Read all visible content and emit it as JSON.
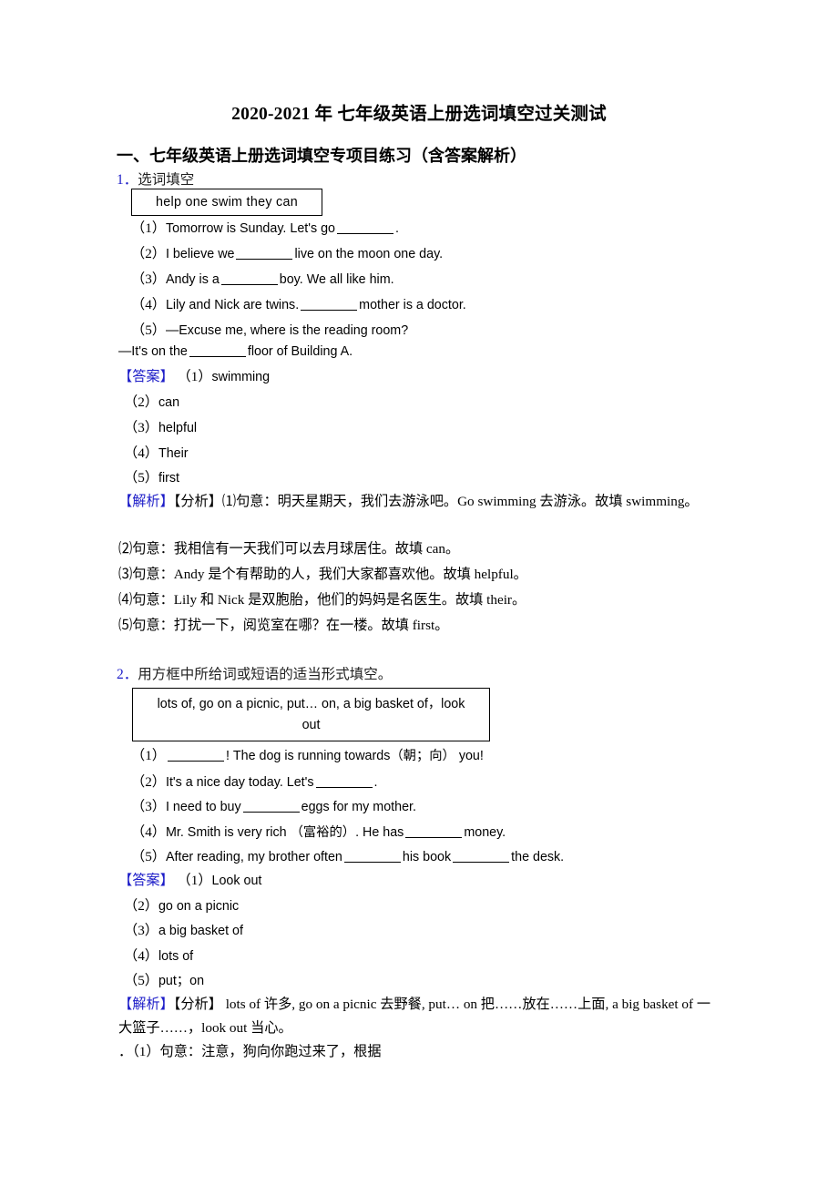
{
  "document": {
    "title": "2020-2021 年  七年级英语上册选词填空过关测试",
    "section_heading": "一、七年级英语上册选词填空专项目练习（含答案解析）",
    "accent_color": "#1d1dc8",
    "text_color": "#000000",
    "background": "#ffffff"
  },
  "exercises": [
    {
      "number": "1．",
      "prompt": "选词填空",
      "wordbank": "help    one    swim    they    can",
      "questions": [
        {
          "label": "（1）",
          "before": "Tomorrow is Sunday. Let's go",
          "after": "."
        },
        {
          "label": "（2）",
          "before": "I believe we",
          "after": "live on the moon one day."
        },
        {
          "label": "（3）",
          "before": "Andy is a",
          "after": "boy. We all like him."
        },
        {
          "label": "（4）",
          "before": "Lily and Nick are twins.",
          "after": "mother is a doctor."
        },
        {
          "label": "（5）",
          "before": "—Excuse me, where is the reading room?",
          "after": ""
        }
      ],
      "continuation": {
        "before": "—It's on the",
        "after": "floor of Building A."
      },
      "answer_label": "【答案】",
      "answers": [
        {
          "label": "（1）",
          "value": "swimming"
        },
        {
          "label": "（2）",
          "value": "can"
        },
        {
          "label": "（3）",
          "value": "helpful"
        },
        {
          "label": "（4）",
          "value": "Their"
        },
        {
          "label": "（5）",
          "value": "first"
        }
      ],
      "analysis_label": "【解析】",
      "analysis_sub_label": "【分析】",
      "analysis_first": "⑴句意：明天星期天，我们去游泳吧。Go swimming 去游泳。故填 swimming。",
      "analysis_items": [
        "⑵句意：我相信有一天我们可以去月球居住。故填 can。",
        "⑶句意：Andy 是个有帮助的人，我们大家都喜欢他。故填 helpful。",
        "⑷句意：Lily 和 Nick 是双胞胎，他们的妈妈是名医生。故填 their。",
        "⑸句意：打扰一下，阅览室在哪？在一楼。故填 first。"
      ]
    },
    {
      "number": "2．",
      "prompt": "用方框中所给词或短语的适当形式填空。",
      "wordbank_line1": "lots   of, go on a picnic, put… on, a big basket of，look",
      "wordbank_line2": "out",
      "questions": [
        {
          "label": "（1）",
          "before": "",
          "after": "! The dog is running towards（朝；向） you!"
        },
        {
          "label": "（2）",
          "before": "It's a nice day today. Let's",
          "after": "."
        },
        {
          "label": "（3）",
          "before": "I need to buy",
          "after": "eggs for my mother."
        },
        {
          "label": "（4）",
          "before": "Mr. Smith is very rich （富裕的）. He has",
          "after": "money."
        },
        {
          "label": "（5）",
          "before": "After reading, my brother often",
          "mid": "his book",
          "after": "the desk."
        }
      ],
      "answer_label": "【答案】",
      "answers": [
        {
          "label": "（1）",
          "value": "Look out"
        },
        {
          "label": "（2）",
          "value": "go on a picnic"
        },
        {
          "label": "（3）",
          "value": "a big basket of"
        },
        {
          "label": "（4）",
          "value": "lots of"
        },
        {
          "label": "（5）",
          "value": "put；on"
        }
      ],
      "analysis_label": "【解析】",
      "analysis_sub_label": "【分析】",
      "analysis_body": " lots of 许多, go on a picnic 去野餐, put… on 把……放在……上面, a big basket of 一大篮子……，look out 当心。",
      "analysis_last": "．（1）句意：注意，狗向你跑过来了，根据"
    }
  ]
}
